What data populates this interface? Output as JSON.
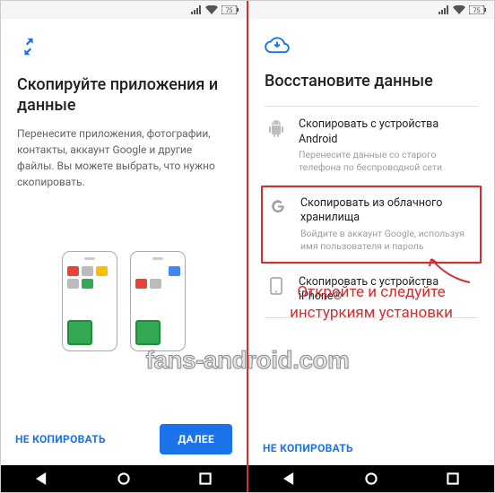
{
  "left": {
    "title": "Скопируйте приложения и данные",
    "desc": "Перенесите приложения, фотографии, контакты, аккаунт Google и другие файлы. Вы можете выбрать, что нужно скопировать.",
    "btn_skip": "Не копировать",
    "btn_next": "Далее"
  },
  "right": {
    "title": "Восстановите данные",
    "items": [
      {
        "title": "Скопировать с устройства Android",
        "sub": "Перенесите данные со старого телефона по беспроводной сети"
      },
      {
        "title": "Скопировать из облачного хранилища",
        "sub": "Войдите в аккаунт Google, используя имя пользователя и пароль"
      },
      {
        "title": "Скопировать с устройства iPhone®",
        "sub": ""
      }
    ],
    "btn_skip": "Не копировать"
  },
  "annotation": "Откройте и следуйте инстуркиям установки",
  "watermark": "fans-android.com",
  "status_battery": "75"
}
